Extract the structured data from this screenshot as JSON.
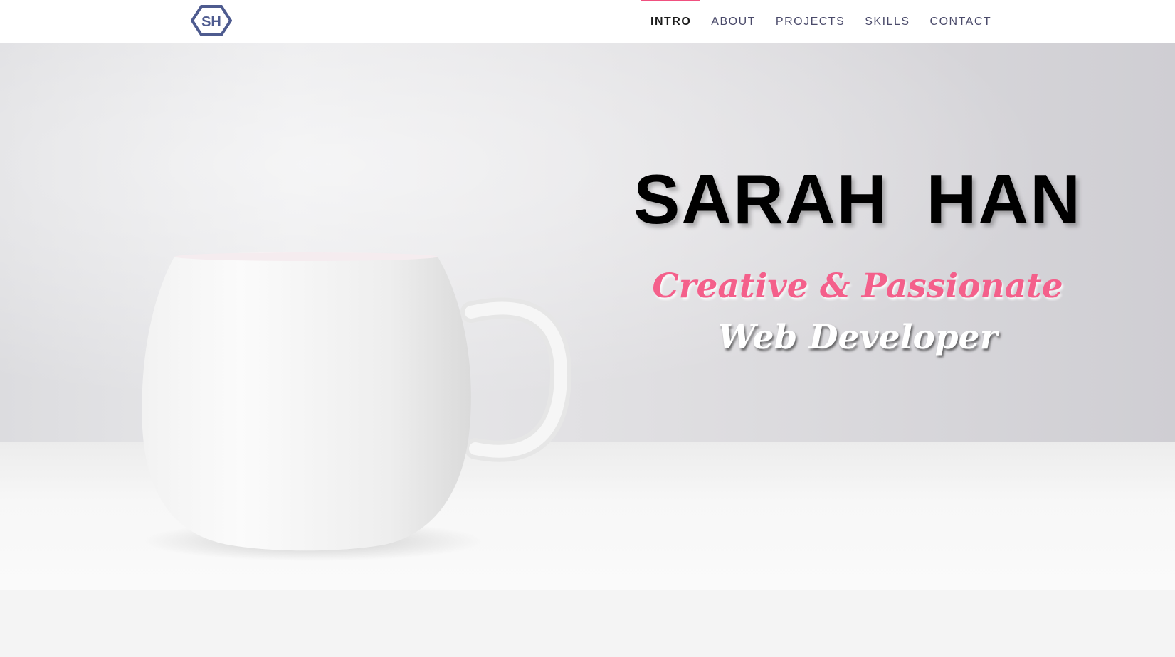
{
  "logo": {
    "text": "SH",
    "color": "#4e5b8f"
  },
  "nav": {
    "items": [
      {
        "label": "INTRO",
        "active": true
      },
      {
        "label": "ABOUT",
        "active": false
      },
      {
        "label": "PROJECTS",
        "active": false
      },
      {
        "label": "SKILLS",
        "active": false
      },
      {
        "label": "CONTACT",
        "active": false
      }
    ],
    "active_indicator_color": "#f0507f"
  },
  "hero": {
    "name": "SARAH  HAN",
    "tagline": "Creative & Passionate",
    "role": "Web Developer",
    "image": "white-coffee-mug",
    "tagline_color": "#f4608b",
    "role_color": "#ffffff"
  }
}
